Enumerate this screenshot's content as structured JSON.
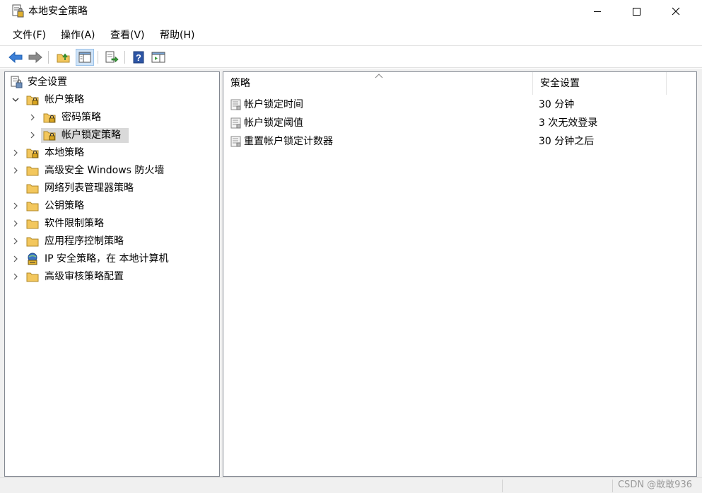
{
  "window": {
    "title": "本地安全策略"
  },
  "menu": [
    {
      "label": "文件(F)"
    },
    {
      "label": "操作(A)"
    },
    {
      "label": "查看(V)"
    },
    {
      "label": "帮助(H)"
    }
  ],
  "toolbar": {
    "icons": [
      "back-arrow-icon",
      "forward-arrow-icon",
      "up-folder-icon",
      "show-hide-tree-icon",
      "export-list-icon",
      "help-icon",
      "show-hide-action-pane-icon"
    ]
  },
  "tree": {
    "root": {
      "label": "安全设置",
      "icon": "security-settings-icon",
      "expanded": true
    },
    "items": [
      {
        "label": "帐户策略",
        "icon": "locked-folder-icon",
        "expanded": true
      },
      {
        "label": "密码策略",
        "icon": "locked-folder-icon"
      },
      {
        "label": "帐户锁定策略",
        "icon": "locked-folder-icon",
        "selected": true
      },
      {
        "label": "本地策略",
        "icon": "locked-folder-icon"
      },
      {
        "label": "高级安全 Windows 防火墙",
        "icon": "folder-icon"
      },
      {
        "label": "网络列表管理器策略",
        "icon": "folder-icon"
      },
      {
        "label": "公钥策略",
        "icon": "folder-icon"
      },
      {
        "label": "软件限制策略",
        "icon": "folder-icon"
      },
      {
        "label": "应用程序控制策略",
        "icon": "folder-icon"
      },
      {
        "label": "IP 安全策略，在 本地计算机",
        "icon": "ip-security-icon"
      },
      {
        "label": "高级审核策略配置",
        "icon": "folder-icon"
      }
    ]
  },
  "list": {
    "columns": [
      {
        "label": "策略"
      },
      {
        "label": "安全设置"
      }
    ],
    "rows": [
      {
        "policy": "帐户锁定时间",
        "setting": "30 分钟"
      },
      {
        "policy": "帐户锁定阈值",
        "setting": "3 次无效登录"
      },
      {
        "policy": "重置帐户锁定计数器",
        "setting": "30 分钟之后"
      }
    ]
  },
  "watermark": "CSDN @敢敢936",
  "colors": {
    "accent_blue": "#3c7fd6",
    "folder_yellow": "#f3c75d",
    "selection_gray": "#d9d9d9",
    "pane_border": "#828790"
  }
}
